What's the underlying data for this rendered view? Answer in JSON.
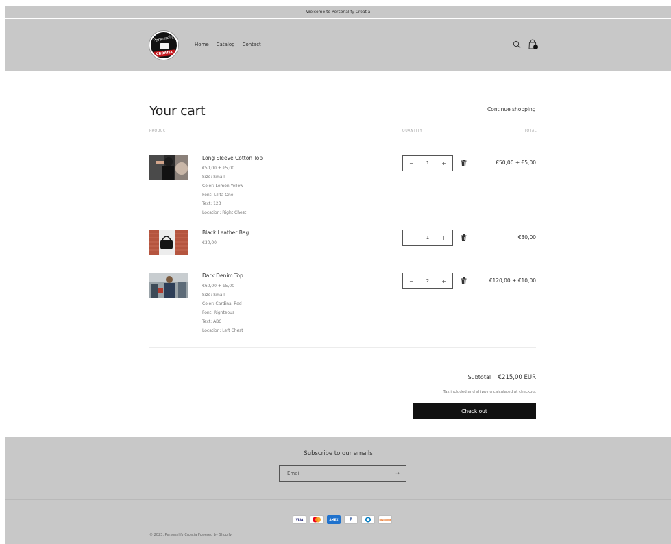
{
  "announcement": "Welcome to Personalify Croatia",
  "header": {
    "logo_text": "Personalify",
    "logo_ribbon": "CROATIA",
    "nav": [
      "Home",
      "Catalog",
      "Contact"
    ]
  },
  "cart": {
    "title": "Your cart",
    "continue": "Continue shopping",
    "col_product": "PRODUCT",
    "col_quantity": "QUANTITY",
    "col_total": "TOTAL",
    "items": [
      {
        "name": "Long Sleeve Cotton Top",
        "price": "€50,00 + €5,00",
        "size": "Size: Small",
        "color": "Color: Lemon Yellow",
        "font": "Font: Lilita One",
        "text": "Text: 123",
        "location": "Location: Right Chest",
        "quantity": "1",
        "total": "€50,00 + €5,00"
      },
      {
        "name": "Black Leather Bag",
        "price": "€30,00",
        "quantity": "1",
        "total": "€30,00"
      },
      {
        "name": "Dark Denim Top",
        "price": "€60,00 + €5,00",
        "size": "Size: Small",
        "color": "Color: Cardinal Red",
        "font": "Font: Righteous",
        "text": "Text: ABC",
        "location": "Location: Left Chest",
        "quantity": "2",
        "total": "€120,00 + €10,00"
      }
    ],
    "subtotal_label": "Subtotal",
    "subtotal_value": "€215,00 EUR",
    "tax_note": "Tax included and shipping calculated at checkout",
    "checkout": "Check out"
  },
  "footer": {
    "subscribe_title": "Subscribe to our emails",
    "email_placeholder": "Email",
    "payments": [
      "VISA",
      "",
      "AMEX",
      "P",
      "",
      "DISCOVER"
    ],
    "copyright": "© 2023, Personalify Croatia Powered by Shopify"
  },
  "colors": {
    "header_bg": "#c8c8c8",
    "checkout_bg": "#111111"
  }
}
